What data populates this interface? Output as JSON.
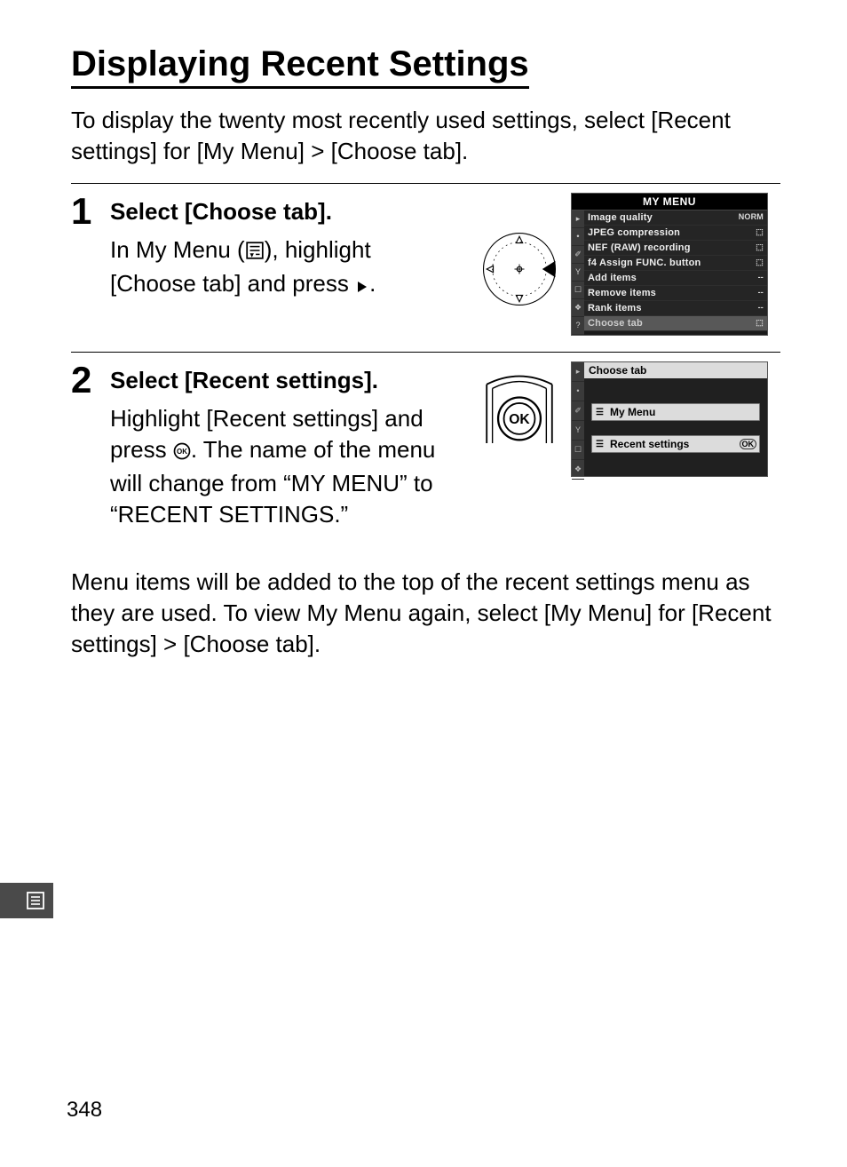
{
  "title": "Displaying Recent Settings",
  "intro": "To display the twenty most recently used settings, select [Recent settings] for [My Menu] > [Choose tab].",
  "steps": [
    {
      "num": "1",
      "heading": "Select [Choose tab].",
      "text_a": "In My Menu (",
      "text_b": "), highlight [Choose tab] and press ",
      "text_c": "."
    },
    {
      "num": "2",
      "heading": "Select [Recent settings].",
      "text_a": "Highlight [Recent settings] and press ",
      "text_b": ".  The name of the menu will change from “MY MENU” to “RECENT SETTINGS.”"
    }
  ],
  "after": "Menu items will be added to the top of the recent settings menu as they are used.  To view My Menu again, select [My Menu] for [Recent settings] > [Choose tab].",
  "screen1": {
    "title": "MY MENU",
    "rows": [
      {
        "label": "Image quality",
        "value": "NORM"
      },
      {
        "label": "JPEG compression",
        "value": "⬚"
      },
      {
        "label": "NEF (RAW) recording",
        "value": "⬚"
      },
      {
        "label": "f4 Assign FUNC. button",
        "value": "⬚"
      },
      {
        "label": "Add items",
        "value": "--"
      },
      {
        "label": "Remove items",
        "value": "--"
      },
      {
        "label": "Rank items",
        "value": "--"
      },
      {
        "label": "Choose tab",
        "value": "⬚"
      }
    ],
    "tabs": [
      "▸",
      "•",
      "✐",
      "Y",
      "☐",
      "❖",
      "?"
    ]
  },
  "screen2": {
    "title": "Choose tab",
    "opt_my": "My Menu",
    "opt_rs": "Recent settings",
    "ok": "OK",
    "tabs": [
      "▸",
      "•",
      "✐",
      "Y",
      "☐",
      "❖"
    ]
  },
  "page_number": "348",
  "icons": {
    "mymenu": "mymenu-icon",
    "right": "right-triangle-icon",
    "ok": "ok-circle-icon"
  }
}
